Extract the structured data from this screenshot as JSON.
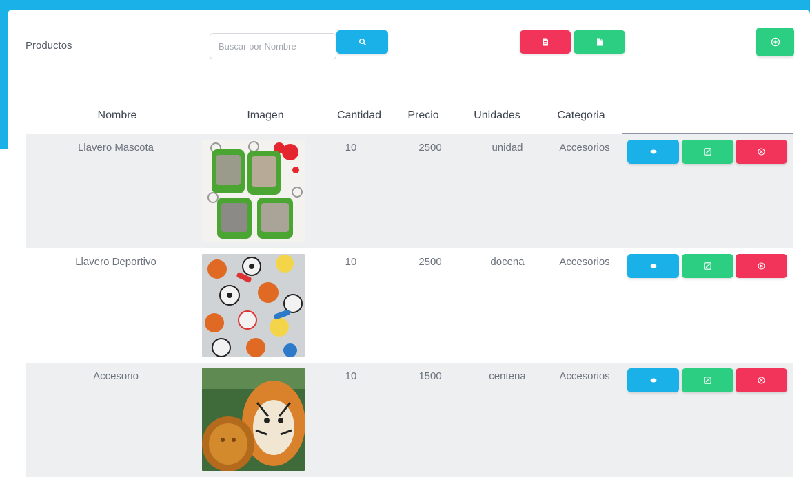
{
  "page": {
    "title": "Productos",
    "search": {
      "placeholder": "Buscar por Nombre",
      "value": ""
    }
  },
  "toolbar": {
    "search_button_icon": "search-icon",
    "pdf_button_icon": "pdf-file-icon",
    "excel_button_icon": "excel-file-icon",
    "add_button_icon": "plus-circle-icon"
  },
  "table": {
    "columns": [
      "Nombre",
      "Imagen",
      "Cantidad",
      "Precio",
      "Unidades",
      "Categoria"
    ],
    "rows": [
      {
        "nombre": "Llavero Mascota",
        "imagen": "keychain-pets-photo",
        "cantidad": "10",
        "precio": "2500",
        "unidades": "unidad",
        "categoria": "Accesorios"
      },
      {
        "nombre": "Llavero Deportivo",
        "imagen": "keychain-sports-photo",
        "cantidad": "10",
        "precio": "2500",
        "unidades": "docena",
        "categoria": "Accesorios"
      },
      {
        "nombre": "Accesorio",
        "imagen": "tiger-accessory-photo",
        "cantidad": "10",
        "precio": "1500",
        "unidades": "centena",
        "categoria": "Accesorios"
      }
    ],
    "row_actions": {
      "view_icon": "eye-icon",
      "edit_icon": "edit-icon",
      "delete_icon": "times-circle-icon"
    }
  },
  "colors": {
    "accent_blue": "#1ab0e8",
    "danger_red": "#f2335a",
    "success_green": "#2ccf81",
    "row_shade": "#eeeff1"
  }
}
